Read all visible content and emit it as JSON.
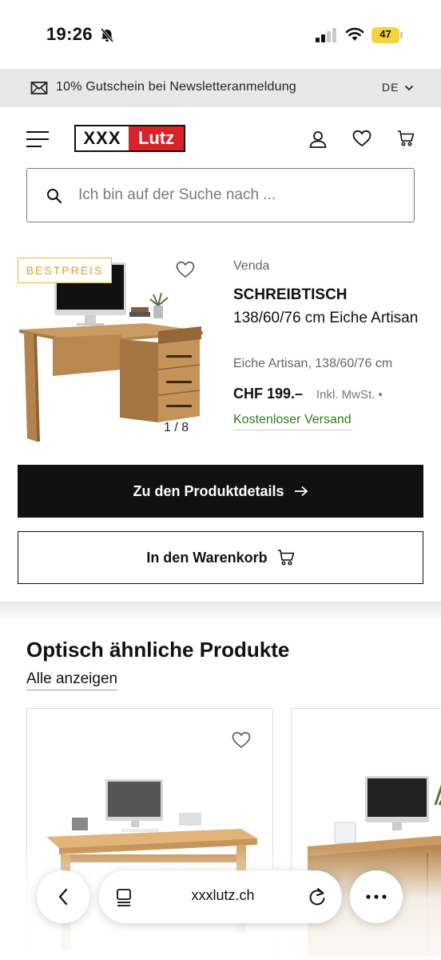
{
  "status_bar": {
    "time": "19:26",
    "battery": "47"
  },
  "banner": {
    "text": "10% Gutschein bei Newsletteranmeldung",
    "language": "DE"
  },
  "header": {
    "logo_part1": "XXX",
    "logo_part2": "Lutz",
    "search_placeholder": "Ich bin auf der Suche nach ..."
  },
  "product": {
    "badge": "BESTPREIS",
    "brand": "Venda",
    "title_strong": "SCHREIBTISCH",
    "title_rest": "138/60/76 cm Eiche Artisan",
    "variant": "Eiche Artisan, 138/60/76 cm",
    "price": "CHF 199.–",
    "tax": "Inkl. MwSt. •",
    "shipping": "Kostenloser Versand",
    "pager": "1 / 8",
    "details_button": "Zu den Produktdetails",
    "cart_button": "In den Warenkorb"
  },
  "similar": {
    "title": "Optisch ähnliche Produkte",
    "see_all": "Alle anzeigen"
  },
  "browser": {
    "url": "xxxlutz.ch"
  },
  "colors": {
    "brand_red": "#d8232a",
    "badge_gold": "#e0a020",
    "shipping_green": "#2e7d1f",
    "battery_yellow": "#f4d33c"
  },
  "icons": [
    "bell-slash-icon",
    "signal-icon",
    "wifi-icon",
    "battery-icon",
    "mail-icon",
    "chevron-down-icon",
    "menu-icon",
    "user-icon",
    "heart-icon",
    "cart-icon",
    "search-icon",
    "arrow-right-icon",
    "back-icon",
    "tabs-icon",
    "reload-icon",
    "more-icon"
  ]
}
